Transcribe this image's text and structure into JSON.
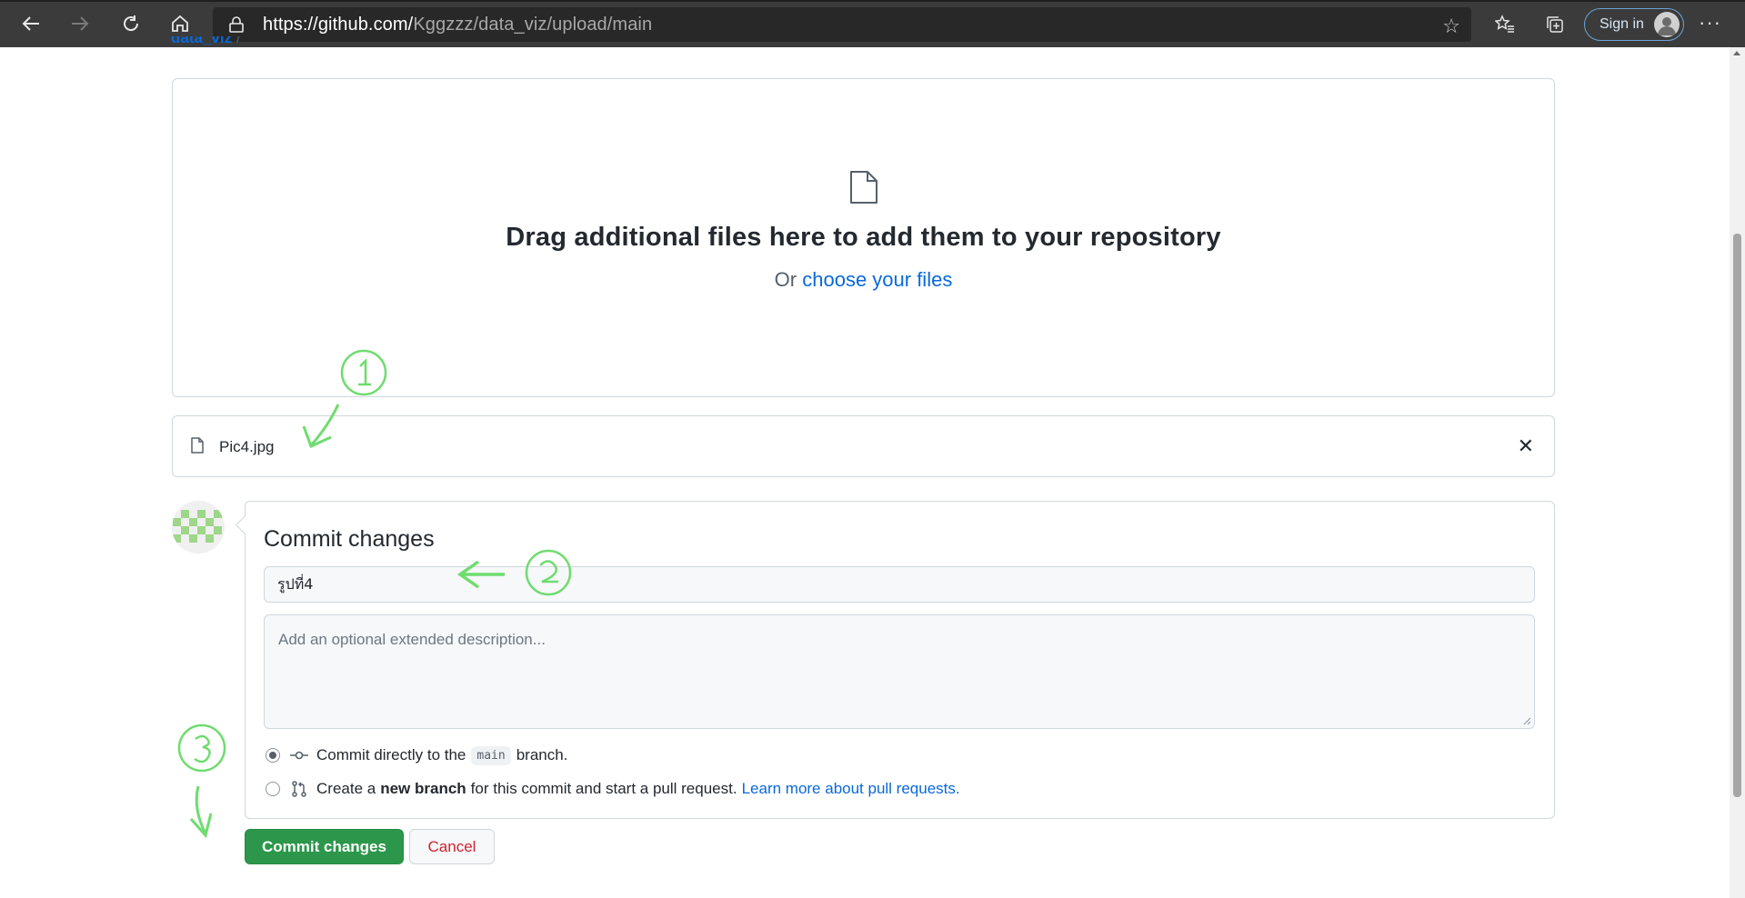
{
  "browser": {
    "url_host": "https://github.com/",
    "url_path": "Kggzzz/data_viz/upload/main",
    "signin_label": "Sign in",
    "icons": [
      "back-icon",
      "forward-icon",
      "refresh-icon",
      "home-icon",
      "lock-icon",
      "favorite-star-icon",
      "favorites-icon",
      "collections-icon",
      "profile-icon",
      "more-icon"
    ]
  },
  "breadcrumb": {
    "repo": "data_viz",
    "separator": "/"
  },
  "dropzone": {
    "title": "Drag additional files here to add them to your repository",
    "prefix": "Or",
    "link": "choose your files"
  },
  "files": [
    {
      "name": "Pic4.jpg"
    }
  ],
  "commit": {
    "heading": "Commit changes",
    "summary_value": "รูปที่4",
    "description_placeholder": "Add an optional extended description...",
    "option_direct": {
      "prefix": "Commit directly to the",
      "branch": "main",
      "suffix": "branch."
    },
    "option_new_branch": {
      "prefix": "Create a",
      "bold": "new branch",
      "suffix": "for this commit and start a pull request.",
      "link": "Learn more about pull requests."
    },
    "selected_option": "direct",
    "submit_label": "Commit changes",
    "cancel_label": "Cancel"
  },
  "annotations": {
    "color": "#6fdc6f",
    "marks": [
      "1",
      "2",
      "3"
    ]
  },
  "colors": {
    "primary_button": "#2c974b",
    "link": "#0969da",
    "danger": "#cf222e"
  }
}
